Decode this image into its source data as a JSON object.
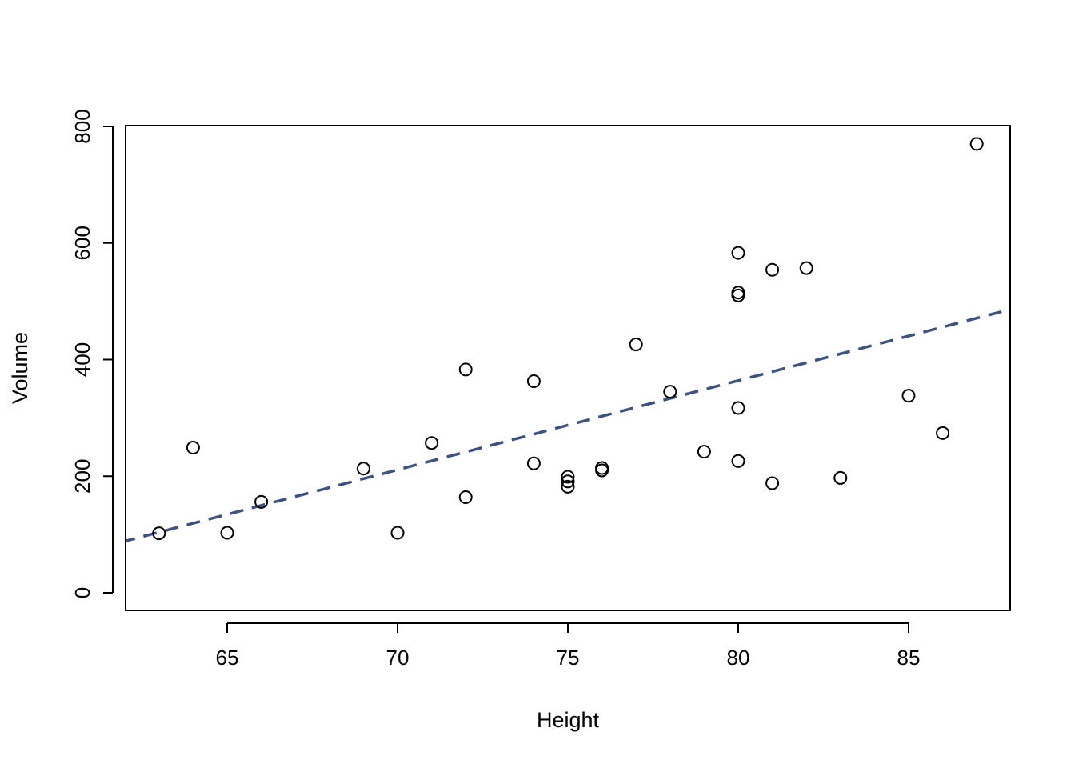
{
  "chart_data": {
    "type": "scatter",
    "title": "",
    "xlabel": "Height",
    "ylabel": "Volume",
    "xlim": [
      62,
      88
    ],
    "ylim": [
      -30,
      800
    ],
    "xticks": [
      65,
      70,
      75,
      80,
      85
    ],
    "yticks": [
      0,
      200,
      400,
      600,
      800
    ],
    "xtick_labels": [
      "65",
      "70",
      "75",
      "80",
      "85"
    ],
    "ytick_labels": [
      "0",
      "200",
      "400",
      "600",
      "800"
    ],
    "grid": false,
    "legend": null,
    "points": [
      {
        "x": 70,
        "y": 103
      },
      {
        "x": 65,
        "y": 103
      },
      {
        "x": 63,
        "y": 102
      },
      {
        "x": 72,
        "y": 164
      },
      {
        "x": 81,
        "y": 188
      },
      {
        "x": 83,
        "y": 197
      },
      {
        "x": 66,
        "y": 156
      },
      {
        "x": 75,
        "y": 182
      },
      {
        "x": 80,
        "y": 226
      },
      {
        "x": 75,
        "y": 199
      },
      {
        "x": 79,
        "y": 242
      },
      {
        "x": 76,
        "y": 210
      },
      {
        "x": 76,
        "y": 214
      },
      {
        "x": 69,
        "y": 213
      },
      {
        "x": 75,
        "y": 191
      },
      {
        "x": 74,
        "y": 222
      },
      {
        "x": 85,
        "y": 338
      },
      {
        "x": 86,
        "y": 274
      },
      {
        "x": 71,
        "y": 257
      },
      {
        "x": 64,
        "y": 249
      },
      {
        "x": 78,
        "y": 345
      },
      {
        "x": 80,
        "y": 317
      },
      {
        "x": 74,
        "y": 363
      },
      {
        "x": 72,
        "y": 383
      },
      {
        "x": 77,
        "y": 426
      },
      {
        "x": 81,
        "y": 554
      },
      {
        "x": 82,
        "y": 557
      },
      {
        "x": 80,
        "y": 583
      },
      {
        "x": 80,
        "y": 515
      },
      {
        "x": 80,
        "y": 510
      },
      {
        "x": 87,
        "y": 770
      }
    ],
    "regression_line": {
      "style": "dashed",
      "color": "#3b5282",
      "slope": 15.3,
      "intercept": -860
    },
    "point_style": {
      "shape": "open-circle",
      "color": "#000000"
    }
  }
}
